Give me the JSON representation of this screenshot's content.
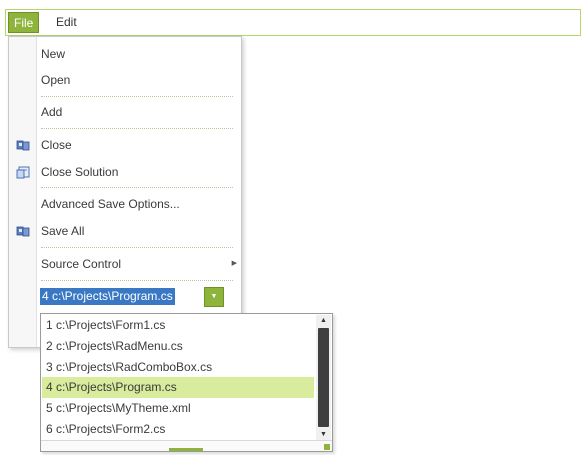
{
  "menubar": {
    "items": [
      {
        "label": "File"
      },
      {
        "label": "Edit"
      }
    ]
  },
  "file_menu": {
    "items": {
      "new": "New",
      "open": "Open",
      "add": "Add",
      "close": "Close",
      "close_solution": "Close Solution",
      "advanced_save": "Advanced Save Options...",
      "save_all": "Save All",
      "source_control": "Source Control"
    },
    "recent_combo": {
      "value": "4 c:\\Projects\\Program.cs",
      "options": [
        "1 c:\\Projects\\Form1.cs",
        "2 c:\\Projects\\RadMenu.cs",
        "3 c:\\Projects\\RadComboBox.cs",
        "4 c:\\Projects\\Program.cs",
        "5 c:\\Projects\\MyTheme.xml",
        "6 c:\\Projects\\Form2.cs"
      ],
      "selected_index": 3
    }
  },
  "colors": {
    "accent": "#8fb43c",
    "selection": "#3a78c4",
    "highlight": "#d9ec9e"
  }
}
